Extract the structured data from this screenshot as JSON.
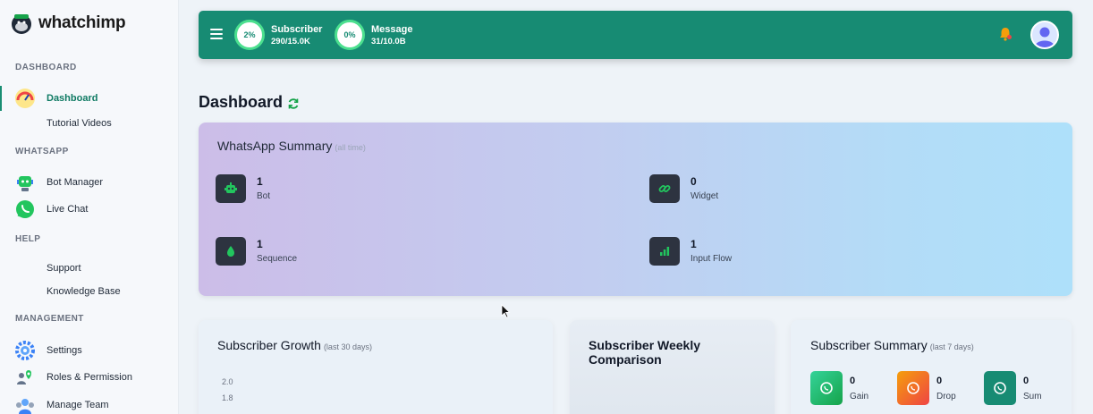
{
  "app": {
    "name": "whatchimp"
  },
  "sidebar": {
    "sections": [
      {
        "title": "DASHBOARD"
      },
      {
        "title": "WHATSAPP"
      },
      {
        "title": "HELP"
      },
      {
        "title": "MANAGEMENT"
      }
    ],
    "items": [
      {
        "label": "Dashboard",
        "icon": "speedometer-icon"
      },
      {
        "label": "Tutorial Videos"
      },
      {
        "label": "Bot Manager",
        "icon": "bot-icon"
      },
      {
        "label": "Live Chat",
        "icon": "whatsapp-icon"
      },
      {
        "label": "Support"
      },
      {
        "label": "Knowledge Base"
      },
      {
        "label": "Settings",
        "icon": "gear-icon"
      },
      {
        "label": "Roles & Permission",
        "icon": "user-lock-icon"
      },
      {
        "label": "Manage Team",
        "icon": "team-icon"
      }
    ]
  },
  "header": {
    "subscriber": {
      "percent": "2%",
      "label": "Subscriber",
      "count": "290/15.0K"
    },
    "message": {
      "percent": "0%",
      "label": "Message",
      "count": "31/10.0B"
    }
  },
  "page": {
    "title": "Dashboard"
  },
  "whatsapp_summary": {
    "title": "WhatsApp Summary",
    "subtitle": "(all time)",
    "items": [
      {
        "value": "1",
        "label": "Bot",
        "icon": "robot-icon"
      },
      {
        "value": "0",
        "label": "Widget",
        "icon": "link-icon"
      },
      {
        "value": "1",
        "label": "Sequence",
        "icon": "drop-icon"
      },
      {
        "value": "1",
        "label": "Input Flow",
        "icon": "chart-icon"
      }
    ]
  },
  "subscriber_growth": {
    "title": "Subscriber Growth",
    "subtitle": "(last 30 days)",
    "ticks": [
      "2.0",
      "1.8"
    ]
  },
  "weekly_comparison": {
    "title": "Subscriber Weekly",
    "title2": "Comparison"
  },
  "subscriber_summary": {
    "title": "Subscriber Summary",
    "subtitle": "(last 7 days)",
    "items": [
      {
        "value": "0",
        "label": "Gain",
        "color": "#22c55e"
      },
      {
        "value": "0",
        "label": "Drop",
        "color": "#f59e0b"
      },
      {
        "value": "0",
        "label": "Sum",
        "color": "#178b73"
      }
    ]
  },
  "colors": {
    "brand": "#178b73",
    "ring": "#4ce08f"
  }
}
